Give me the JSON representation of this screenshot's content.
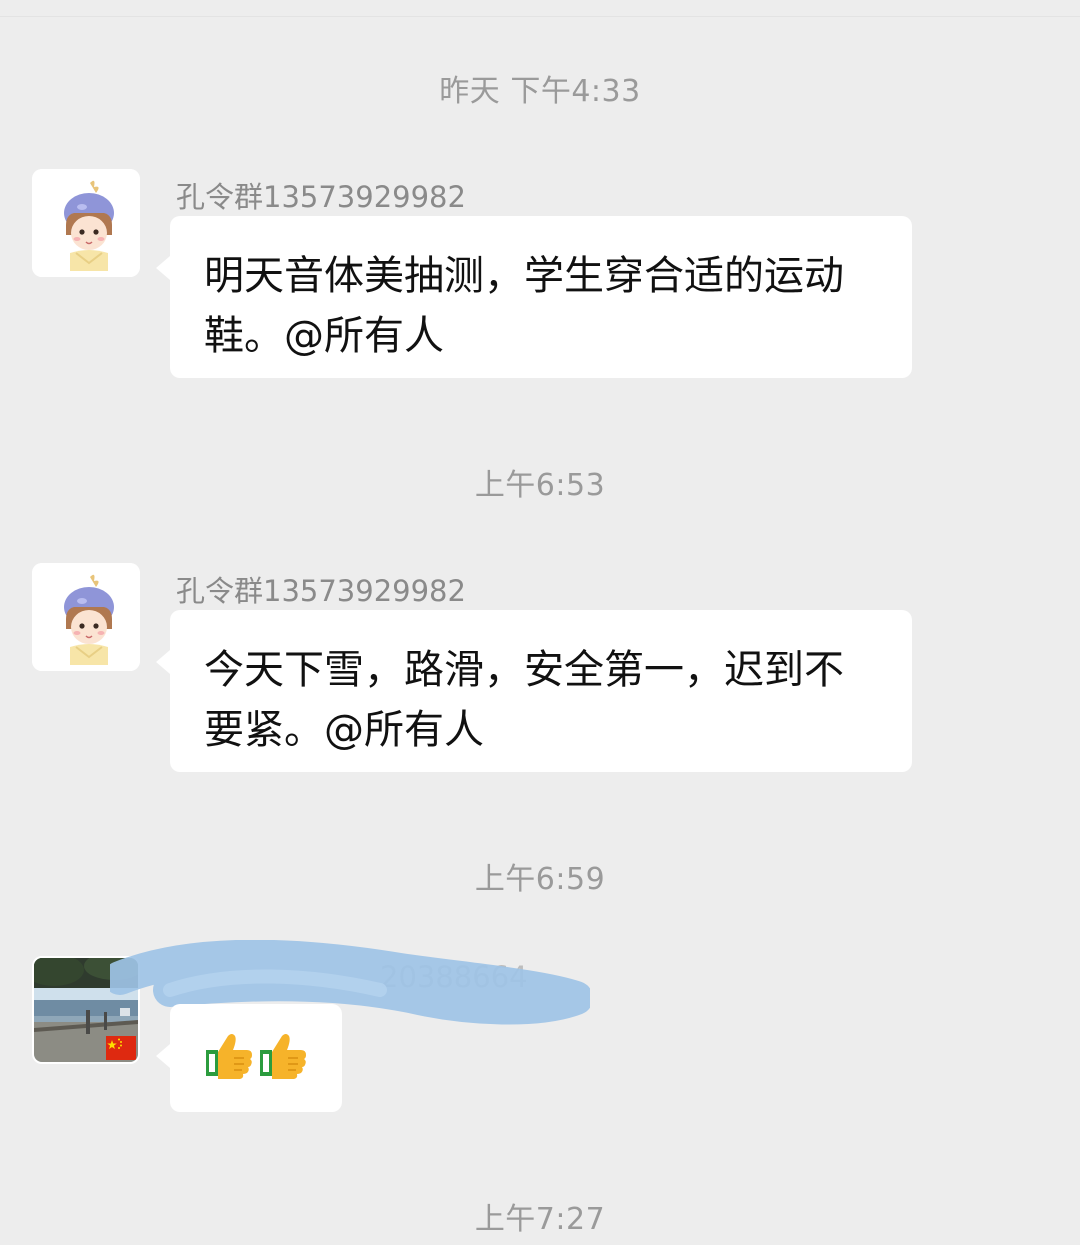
{
  "chat": {
    "messages": [
      {
        "timestamp": "昨天 下午4:33",
        "sender": "孔令群13573929982",
        "text": "明天音体美抽测，学生穿合适的运动鞋。@所有人"
      },
      {
        "timestamp": "上午6:53",
        "sender": "孔令群13573929982",
        "text": "今天下雪，路滑，安全第一，迟到不要紧。@所有人"
      },
      {
        "timestamp": "上午6:59",
        "sender": "20388664",
        "text": "👍👍"
      }
    ],
    "last_timestamp": "上午7:27"
  },
  "icons": {
    "avatar_1": "cartoon-girl-avatar",
    "avatar_3": "lakeside-photo-avatar",
    "flag": "china-flag-icon",
    "emoji": "thumbs-up-icon",
    "redaction": "scribble-redaction"
  },
  "colors": {
    "background": "#ededed",
    "bubble": "#ffffff",
    "timestamp": "#9a9a9a",
    "redaction": "#9ec3e6"
  }
}
